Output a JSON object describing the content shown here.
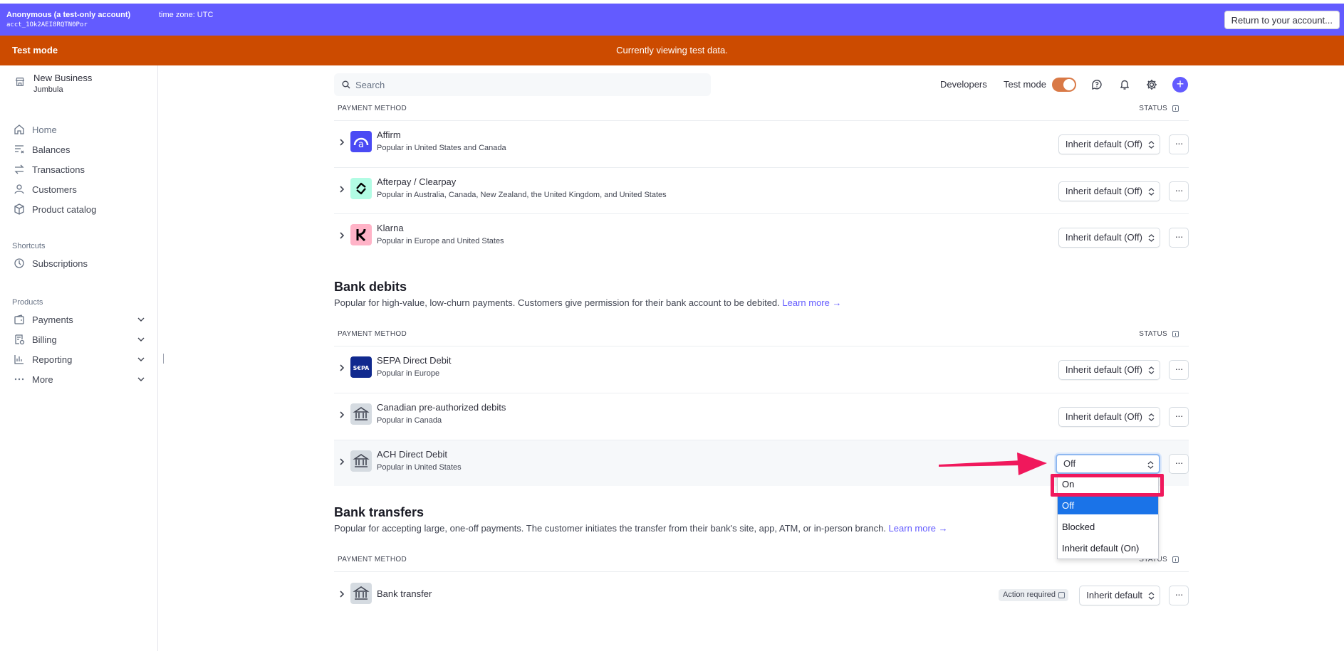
{
  "account_bar": {
    "account_name": "Anonymous (a test-only account)",
    "account_id": "acct_1Ok2AEI8RQTN0Por",
    "timezone": "time zone: UTC",
    "return_button": "Return to your account..."
  },
  "test_banner": {
    "label": "Test mode",
    "message": "Currently viewing test data."
  },
  "sidebar": {
    "business_name": "New Business",
    "business_sub": "Jumbula",
    "nav": [
      {
        "label": "Home",
        "icon": "home-icon"
      },
      {
        "label": "Balances",
        "icon": "balances-icon"
      },
      {
        "label": "Transactions",
        "icon": "transactions-icon"
      },
      {
        "label": "Customers",
        "icon": "customers-icon"
      },
      {
        "label": "Product catalog",
        "icon": "product-catalog-icon"
      }
    ],
    "shortcuts_label": "Shortcuts",
    "shortcuts": [
      {
        "label": "Subscriptions",
        "icon": "clock-icon"
      }
    ],
    "products_label": "Products",
    "products": [
      {
        "label": "Payments",
        "icon": "payments-icon"
      },
      {
        "label": "Billing",
        "icon": "billing-icon"
      },
      {
        "label": "Reporting",
        "icon": "reporting-icon"
      },
      {
        "label": "More",
        "icon": "more-dots-icon"
      }
    ]
  },
  "header": {
    "search_placeholder": "Search",
    "developers": "Developers",
    "test_mode_label": "Test mode",
    "test_mode_on": true,
    "plus": "+"
  },
  "colors": {
    "brand": "#635bff",
    "test_banner": "#cc4b00",
    "annotation": "#f0185c",
    "selected_option": "#1a73e8"
  },
  "tables": {
    "col_payment_method": "PAYMENT METHOD",
    "col_status": "STATUS"
  },
  "bnpl_rows": [
    {
      "name": "Affirm",
      "desc": "Popular in United States and Canada",
      "status": "Inherit default (Off)",
      "more": "···"
    },
    {
      "name": "Afterpay / Clearpay",
      "desc": "Popular in Australia, Canada, New Zealand, the United Kingdom, and United States",
      "status": "Inherit default (Off)",
      "more": "···"
    },
    {
      "name": "Klarna",
      "desc": "Popular in Europe and United States",
      "status": "Inherit default (Off)",
      "more": "···"
    }
  ],
  "bank_debits": {
    "title": "Bank debits",
    "desc": "Popular for high-value, low-churn payments. Customers give permission for their bank account to be debited.",
    "learn_more": "Learn more →",
    "rows": [
      {
        "name": "SEPA Direct Debit",
        "desc": "Popular in Europe",
        "status": "Inherit default (Off)",
        "more": "···",
        "logo_text": "S€PA"
      },
      {
        "name": "Canadian pre-authorized debits",
        "desc": "Popular in Canada",
        "status": "Inherit default (Off)",
        "more": "···"
      },
      {
        "name": "ACH Direct Debit",
        "desc": "Popular in United States",
        "status": "Off",
        "more": "···"
      }
    ]
  },
  "dropdown": {
    "options": [
      "On",
      "Off",
      "Blocked",
      "Inherit default (On)"
    ],
    "selected": "Off",
    "highlighted": "On"
  },
  "bank_transfers": {
    "title": "Bank transfers",
    "desc": "Popular for accepting large, one-off payments. The customer initiates the transfer from their bank's site, app, ATM, or in-person branch.",
    "learn_more": "Learn more →",
    "rows": [
      {
        "name": "Bank transfer",
        "badge": "Action required",
        "status": "Inherit default",
        "more": "···"
      }
    ]
  }
}
